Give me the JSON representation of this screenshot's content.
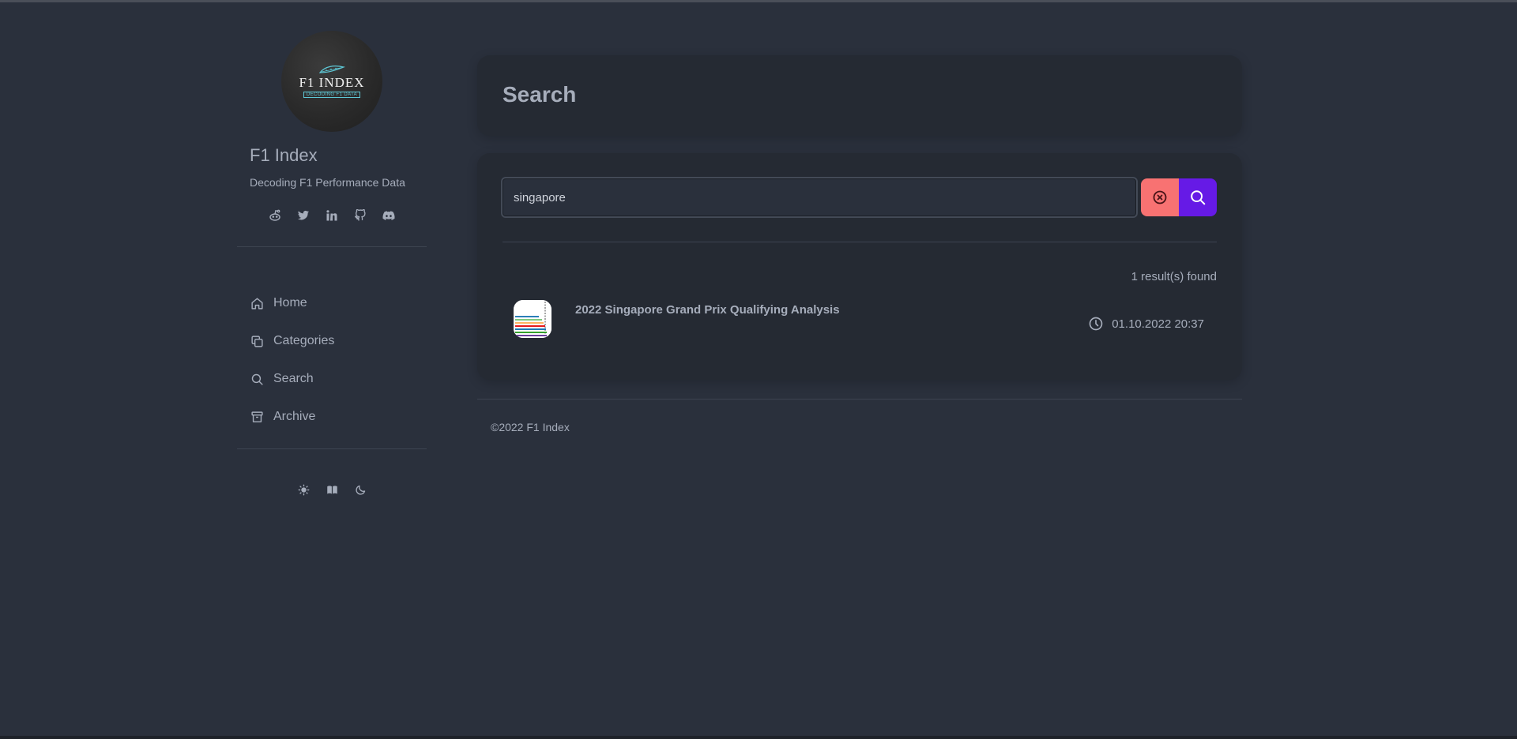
{
  "sidebar": {
    "avatar": {
      "logo_title": "F1 INDEX",
      "logo_subtitle": "DECODING F1 DATA"
    },
    "title": "F1 Index",
    "subtitle": "Decoding F1 Performance Data",
    "socials": [
      {
        "icon": "reddit-icon"
      },
      {
        "icon": "twitter-icon"
      },
      {
        "icon": "linkedin-icon"
      },
      {
        "icon": "github-icon"
      },
      {
        "icon": "discord-icon"
      }
    ],
    "nav": [
      {
        "label": "Home",
        "icon": "home-icon"
      },
      {
        "label": "Categories",
        "icon": "copy-icon"
      },
      {
        "label": "Search",
        "icon": "search-icon"
      },
      {
        "label": "Archive",
        "icon": "archive-icon"
      }
    ],
    "themes": [
      {
        "icon": "sun-icon"
      },
      {
        "icon": "book-icon"
      },
      {
        "icon": "moon-icon"
      }
    ]
  },
  "header": {
    "title": "Search"
  },
  "search": {
    "value": "singapore",
    "result_count": "1 result(s) found",
    "results": [
      {
        "title": "2022 Singapore Grand Prix Qualifying Analysis",
        "date": "01.10.2022 20:37"
      }
    ]
  },
  "footer": {
    "text": "©2022 F1 Index"
  },
  "colors": {
    "background": "#2a303c",
    "card": "#252a33",
    "text": "#a6adbb",
    "clear_button": "#f87272",
    "search_button": "#661ae6"
  }
}
